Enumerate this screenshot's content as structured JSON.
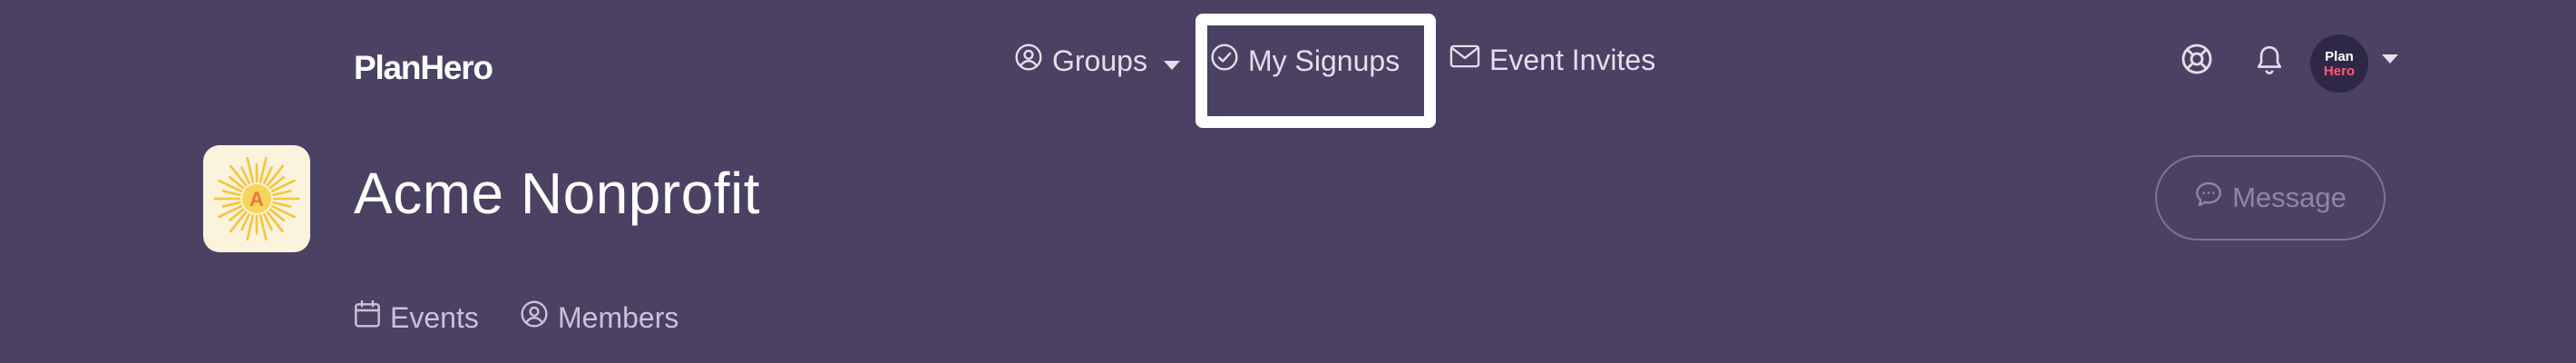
{
  "brand": {
    "name": "PlanHero"
  },
  "nav": {
    "groups": "Groups",
    "my_signups": "My Signups",
    "event_invites": "Event Invites"
  },
  "avatar": {
    "line1": "Plan",
    "line2": "Hero"
  },
  "org": {
    "name": "Acme Nonprofit",
    "logo_letter": "A"
  },
  "actions": {
    "message": "Message"
  },
  "tabs": {
    "events": "Events",
    "members": "Members"
  },
  "icons": {
    "groups": "user-circle-icon",
    "my_signups": "check-circle-icon",
    "event_invites": "envelope-icon",
    "help": "lifebuoy-icon",
    "notifications": "bell-icon",
    "message": "chat-bubble-icon",
    "events": "calendar-icon",
    "members": "user-circle-icon"
  },
  "colors": {
    "background": "#4a4163",
    "text": "#ffffff",
    "muted_text": "#c9c3d8",
    "avatar_bg": "#2e2745",
    "avatar_accent": "#ff5a78",
    "logo_bg": "#fcf3dc",
    "logo_sun": "#f7c33a",
    "logo_letter": "#ee7442",
    "highlight": "#ffffff"
  }
}
